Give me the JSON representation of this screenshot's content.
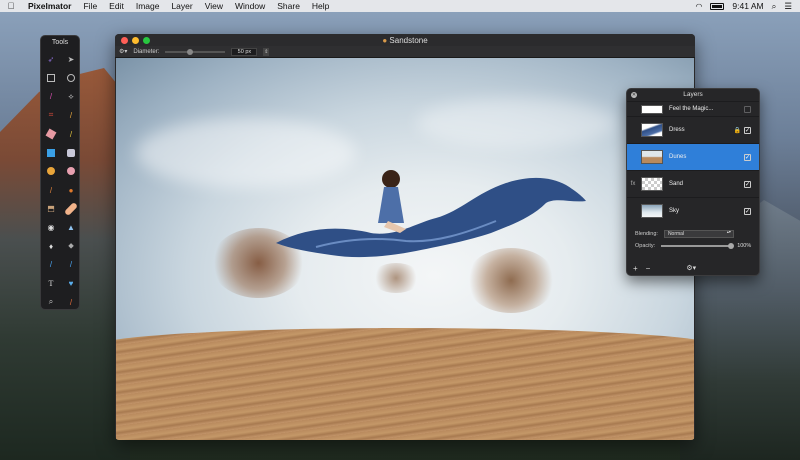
{
  "menubar": {
    "app_name": "Pixelmator",
    "items": [
      "File",
      "Edit",
      "Image",
      "Layer",
      "View",
      "Window",
      "Share",
      "Help"
    ],
    "time": "9:41 AM",
    "icons": [
      "apple-icon",
      "wifi-icon",
      "battery-icon",
      "search-icon",
      "list-icon"
    ]
  },
  "tools": {
    "title": "Tools",
    "items": [
      "lasso-arrow",
      "pointer",
      "rect-select",
      "ellipse-select",
      "brush",
      "lasso",
      "crop",
      "eyedropper",
      "eraser",
      "pencil",
      "shape-rect",
      "paint-bucket",
      "color-blob",
      "sponge",
      "smudge",
      "burn",
      "stamp",
      "bandage",
      "eye",
      "triangle",
      "drop",
      "sharpen",
      "line",
      "pen",
      "type",
      "heart-shape",
      "zoom",
      "color-picker"
    ]
  },
  "document": {
    "title": "Sandstone",
    "options": {
      "diameter_label": "Diameter:",
      "diameter_value": "50 px"
    },
    "traffic_colors": [
      "#ff5f57",
      "#febc2e",
      "#28c840"
    ]
  },
  "layers": {
    "title": "Layers",
    "rows": [
      {
        "name": "Feel the Magic...",
        "fx": "",
        "selected": false,
        "locked": false,
        "visible": false
      },
      {
        "name": "Dress",
        "fx": "",
        "selected": false,
        "locked": true,
        "visible": true
      },
      {
        "name": "Dunes",
        "fx": "",
        "selected": true,
        "locked": false,
        "visible": true
      },
      {
        "name": "Sand",
        "fx": "fx",
        "selected": false,
        "locked": false,
        "visible": true
      },
      {
        "name": "Sky",
        "fx": "",
        "selected": false,
        "locked": false,
        "visible": true
      }
    ],
    "blending_label": "Blending:",
    "blending_value": "Normal",
    "opacity_label": "Opacity:",
    "opacity_value": "100%",
    "opacity_level": 1.0,
    "footer": {
      "add": "+",
      "remove": "−",
      "gear": "⚙▾"
    }
  }
}
